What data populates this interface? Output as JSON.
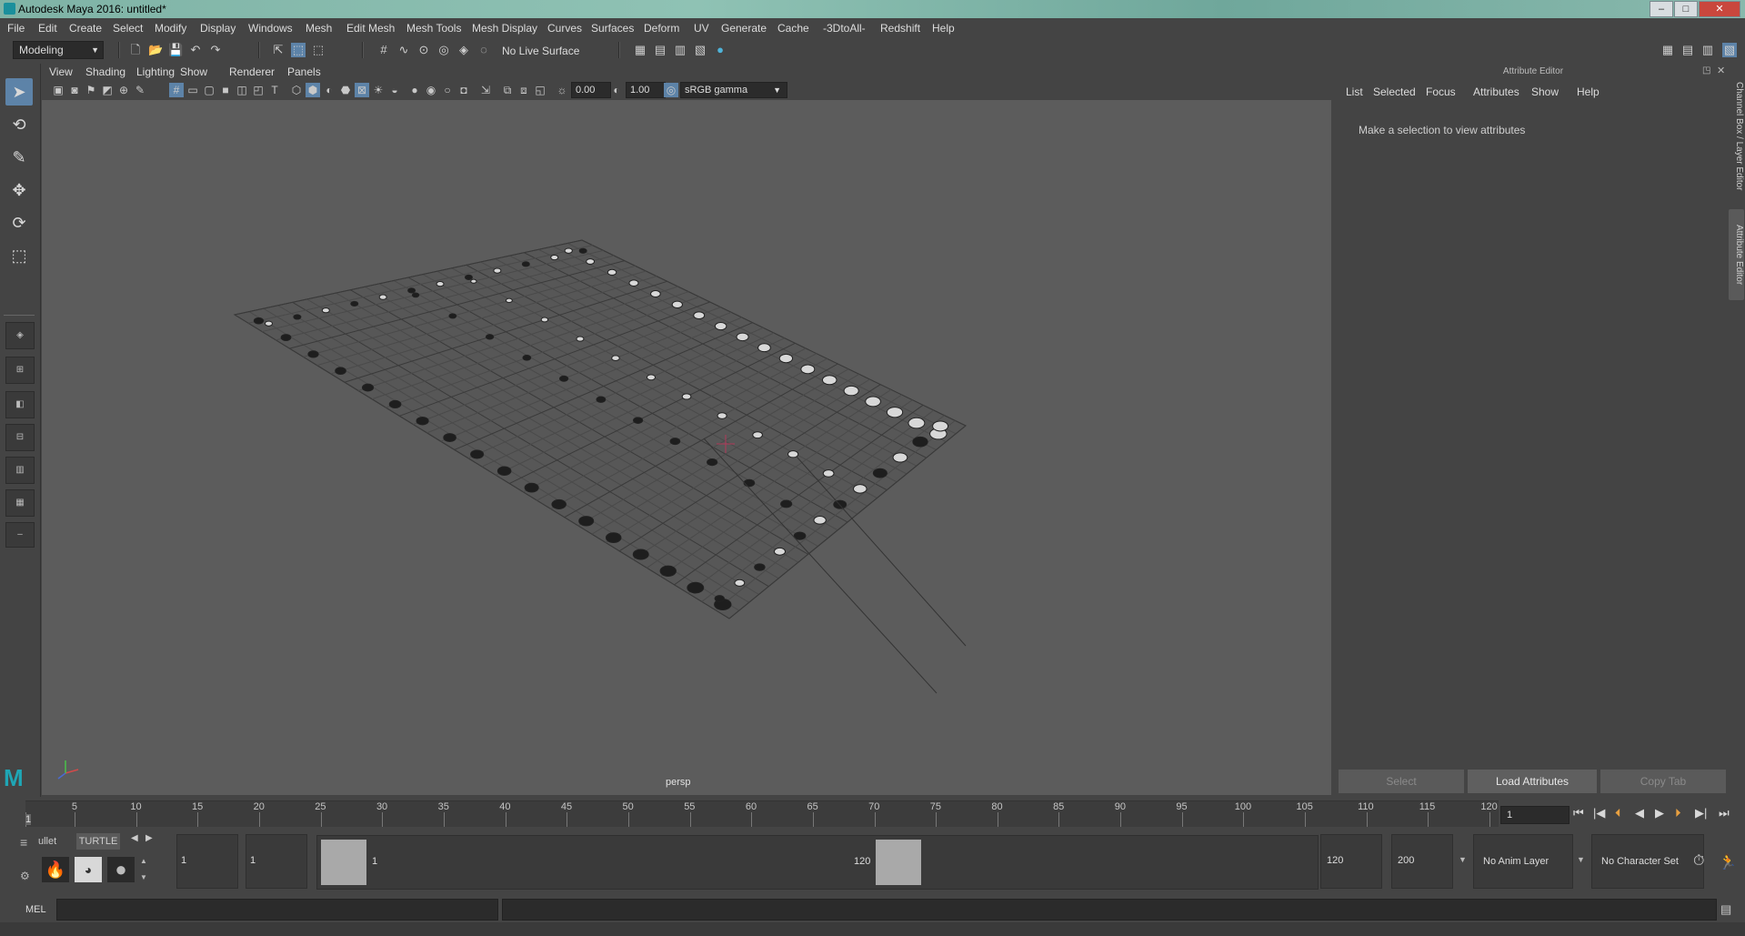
{
  "window": {
    "title": "Autodesk Maya 2016: untitled*",
    "min": "–",
    "max": "□",
    "close": "✕"
  },
  "menubar": [
    "File",
    "Edit",
    "Create",
    "Select",
    "Modify",
    "Display",
    "Windows",
    "Mesh",
    "Edit Mesh",
    "Mesh Tools",
    "Mesh Display",
    "Curves",
    "Surfaces",
    "Deform",
    "UV",
    "Generate",
    "Cache",
    "-3DtoAll-",
    "Redshift",
    "Help"
  ],
  "statusline": {
    "menuset": "Modeling",
    "live_surface": "No Live Surface"
  },
  "viewport": {
    "menu": [
      "View",
      "Shading",
      "Lighting",
      "Show",
      "Renderer",
      "Panels"
    ],
    "exposure": "0.00",
    "gamma": "1.00",
    "colorspace": "sRGB gamma",
    "camera": "persp"
  },
  "attribute_editor": {
    "header": "Attribute Editor",
    "menu": [
      "List",
      "Selected",
      "Focus",
      "Attributes",
      "Show",
      "Help"
    ],
    "message": "Make a selection to view attributes",
    "buttons": {
      "select": "Select",
      "load": "Load Attributes",
      "copy": "Copy Tab"
    },
    "side_tabs": [
      "Channel Box / Layer Editor",
      "Attribute Editor"
    ]
  },
  "timeline": {
    "ticks": [
      1,
      5,
      10,
      15,
      20,
      25,
      30,
      35,
      40,
      45,
      50,
      55,
      60,
      65,
      70,
      75,
      80,
      85,
      90,
      95,
      100,
      105,
      110,
      115,
      120
    ],
    "current_frame": "1",
    "current_marker": "1"
  },
  "range": {
    "shelf_tabs": [
      "ullet",
      "TURTLE"
    ],
    "start_time": "1",
    "playback_start": "1",
    "range_start_label": "1",
    "range_end_label": "120",
    "playback_end": "120",
    "end_time": "200",
    "anim_layer": "No Anim Layer",
    "character_set": "No Character Set"
  },
  "command_line": {
    "label": "MEL"
  }
}
